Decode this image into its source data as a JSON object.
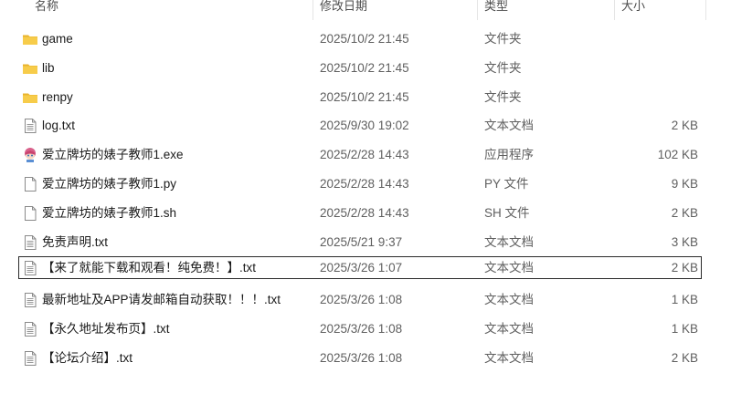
{
  "header": {
    "name": "名称",
    "date": "修改日期",
    "type": "类型",
    "size": "大小"
  },
  "files": [
    {
      "name": "game",
      "date": "2025/10/2 21:45",
      "type": "文件夹",
      "size": "",
      "icon": "folder-icon"
    },
    {
      "name": "lib",
      "date": "2025/10/2 21:45",
      "type": "文件夹",
      "size": "",
      "icon": "folder-icon"
    },
    {
      "name": "renpy",
      "date": "2025/10/2 21:45",
      "type": "文件夹",
      "size": "",
      "icon": "folder-icon"
    },
    {
      "name": "log.txt",
      "date": "2025/9/30 19:02",
      "type": "文本文档",
      "size": "2 KB",
      "icon": "text-document-icon"
    },
    {
      "name": "爱立牌坊的婊子教师1.exe",
      "date": "2025/2/28 14:43",
      "type": "应用程序",
      "size": "102 KB",
      "icon": "app-character-icon"
    },
    {
      "name": "爱立牌坊的婊子教师1.py",
      "date": "2025/2/28 14:43",
      "type": "PY 文件",
      "size": "9 KB",
      "icon": "blank-file-icon"
    },
    {
      "name": "爱立牌坊的婊子教师1.sh",
      "date": "2025/2/28 14:43",
      "type": "SH 文件",
      "size": "2 KB",
      "icon": "blank-file-icon"
    },
    {
      "name": "免责声明.txt",
      "date": "2025/5/21 9:37",
      "type": "文本文档",
      "size": "3 KB",
      "icon": "text-document-icon"
    },
    {
      "name": "【来了就能下载和观看！纯免费！】.txt",
      "date": "2025/3/26 1:07",
      "type": "文本文档",
      "size": "2 KB",
      "icon": "text-document-icon",
      "selected": true
    },
    {
      "name": "最新地址及APP请发邮箱自动获取！！！.txt",
      "date": "2025/3/26 1:08",
      "type": "文本文档",
      "size": "1 KB",
      "icon": "text-document-icon"
    },
    {
      "name": "【永久地址发布页】.txt",
      "date": "2025/3/26 1:08",
      "type": "文本文档",
      "size": "1 KB",
      "icon": "text-document-icon"
    },
    {
      "name": "【论坛介绍】.txt",
      "date": "2025/3/26 1:08",
      "type": "文本文档",
      "size": "2 KB",
      "icon": "text-document-icon"
    }
  ],
  "colors": {
    "folder": "#f4c542",
    "selection_border": "#2a2a2a"
  }
}
